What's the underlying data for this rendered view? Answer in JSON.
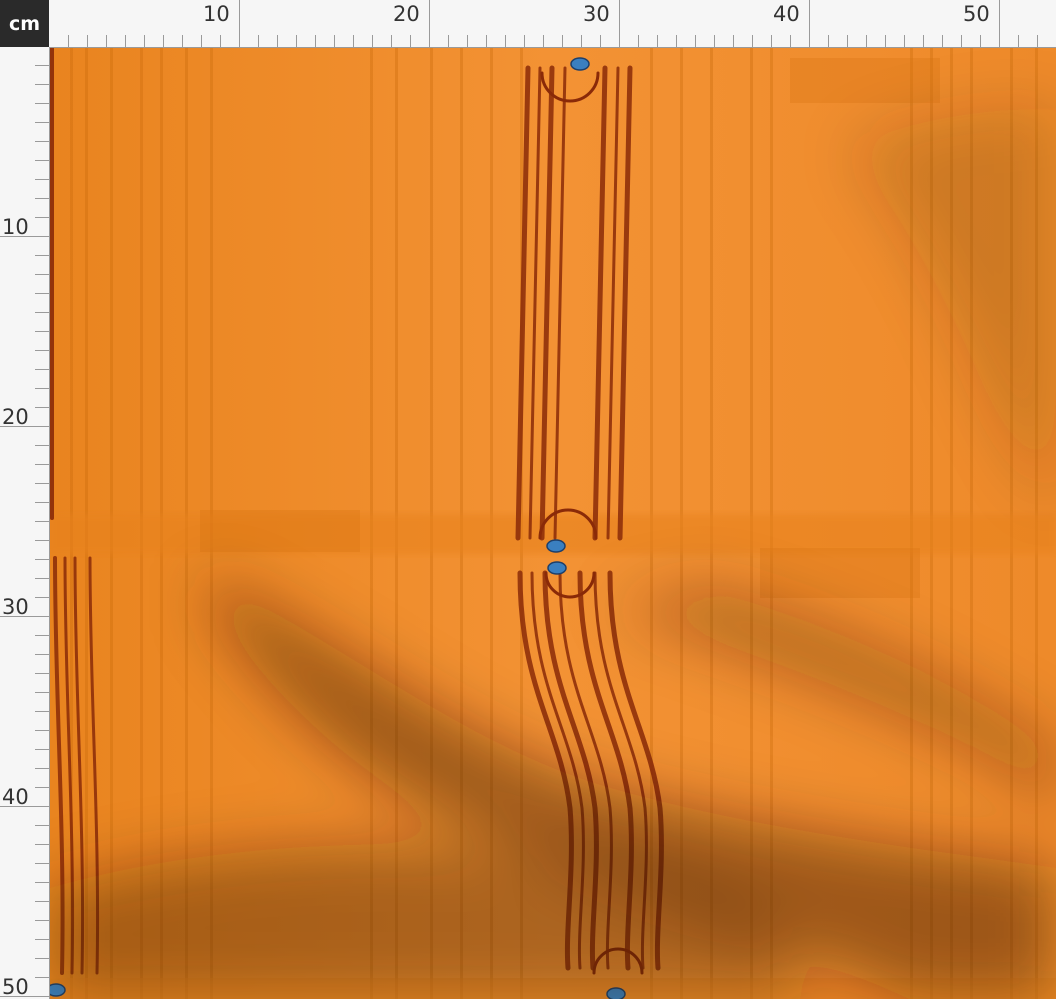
{
  "ruler": {
    "unit": "cm",
    "top_labels": [
      "10",
      "20",
      "30",
      "40",
      "50"
    ],
    "left_labels": [
      "10",
      "20",
      "30",
      "40",
      "50"
    ]
  },
  "fabric": {
    "base_color": "#f08c2c",
    "stripe_color": "#8a2a08",
    "ornament_color": "#3a7fc0",
    "shadow_color": "#3b1d00"
  }
}
